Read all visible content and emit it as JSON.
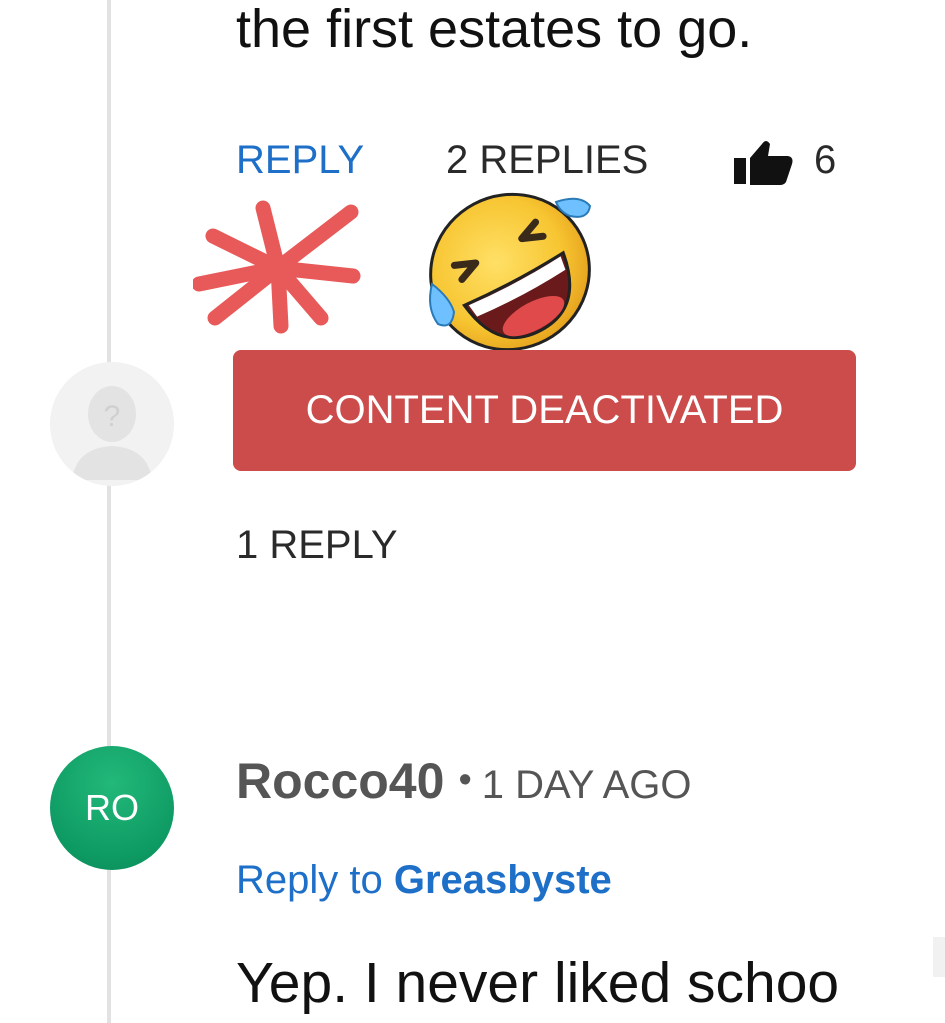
{
  "comment_top": {
    "text_tail": "the first estates to go.",
    "actions": {
      "reply_label": "REPLY",
      "replies_label": "2 REPLIES",
      "like_icon": "thumbs-up-icon",
      "like_count": "6"
    }
  },
  "overlays": {
    "asterisk_icon": "red-asterisk-scribble",
    "emoji_icon": "rolling-on-floor-laughing-emoji",
    "colors": {
      "asterisk": "#e85a5a"
    }
  },
  "deactivated_comment": {
    "avatar_icon": "unknown-user-icon",
    "avatar_glyph": "?",
    "status_label": "CONTENT DEACTIVATED",
    "replies_label": "1 REPLY",
    "badge_color": "#cc4b4b"
  },
  "reply_comment": {
    "avatar_initials": "RO",
    "avatar_color": "#0e9a63",
    "author": "Rocco40",
    "separator": "•",
    "time_ago": "1 DAY AGO",
    "reply_to_prefix": "Reply to",
    "reply_to_user": "Greasbyste",
    "text_start": "Yep. I never liked schoo"
  },
  "colors": {
    "link": "#1e6fc8",
    "text": "#111111",
    "muted": "#555555",
    "thread_line": "#e2e2e2"
  }
}
